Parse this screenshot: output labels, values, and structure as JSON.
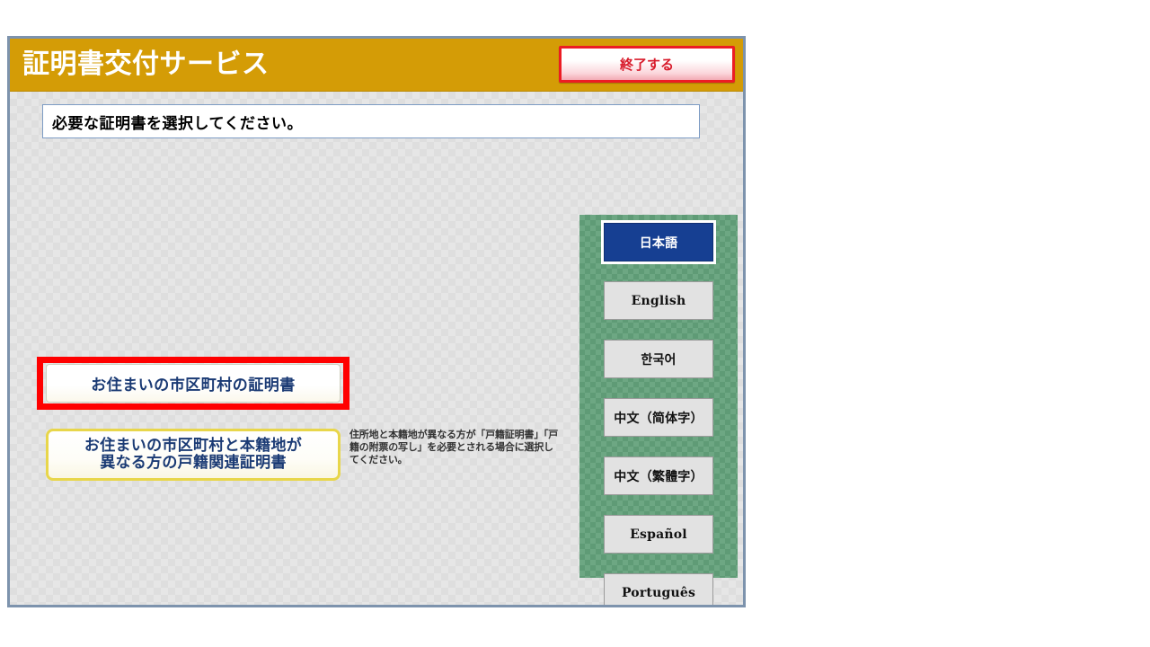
{
  "window": {
    "frame_border_color": "#7d93ad"
  },
  "header": {
    "title": "証明書交付サービス",
    "background_color": "#d49c06",
    "exit_button": {
      "label": "終了する",
      "border_color": "#ec1c24",
      "text_color": "#d81b2b"
    }
  },
  "message": {
    "text": "必要な証明書を選択してください。"
  },
  "choices": {
    "resident": {
      "label": "お住まいの市区町村の証明書",
      "highlight_color": "#ff0000",
      "highlighted": true
    },
    "koseki": {
      "line1": "お住まいの市区町村と本籍地が",
      "line2": "異なる方の戸籍関連証明書",
      "border_color": "#e8d64a",
      "note": "住所地と本籍地が異なる方が「戸籍証明書」「戸籍の附票の写し」を必要とされる場合に選択してください。"
    }
  },
  "language_panel": {
    "background_color": "#6da783",
    "selected_index": 0,
    "selected_color": "#163f92",
    "buttons": [
      {
        "label": "日本語",
        "style": "cjk",
        "selected": true
      },
      {
        "label": "English",
        "style": "latin",
        "selected": false
      },
      {
        "label": "한국어",
        "style": "cjk",
        "selected": false
      },
      {
        "label": "中文（简体字）",
        "style": "cjk",
        "selected": false
      },
      {
        "label": "中文（繁體字）",
        "style": "cjk",
        "selected": false
      },
      {
        "label": "Español",
        "style": "latin",
        "selected": false
      },
      {
        "label": "Português",
        "style": "latin",
        "selected": false
      }
    ]
  }
}
